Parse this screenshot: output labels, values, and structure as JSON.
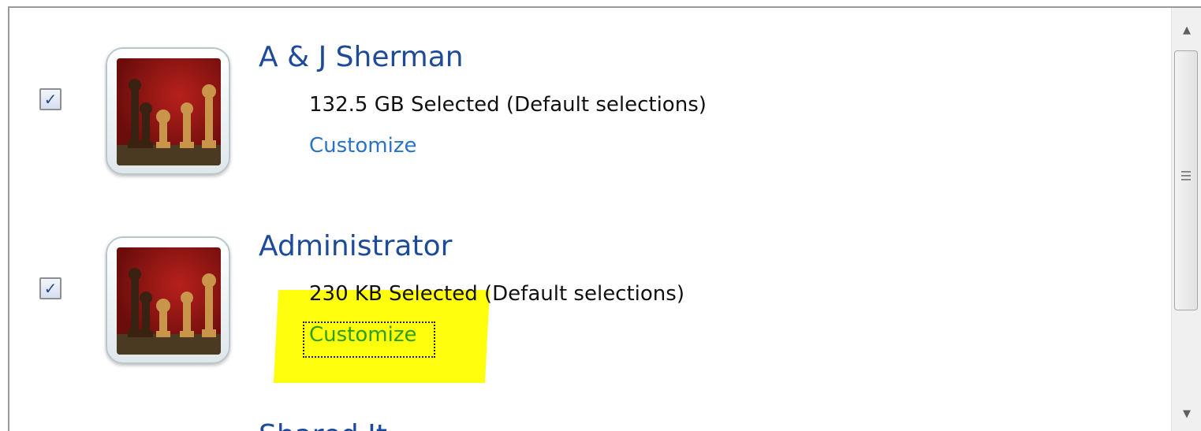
{
  "users": [
    {
      "name": "A & J Sherman",
      "selection": "132.5 GB Selected (Default selections)",
      "customize_label": "Customize",
      "checked": true,
      "avatar_icon": "chess-pieces-icon"
    },
    {
      "name": "Administrator",
      "selection": "230 KB Selected (Default selections)",
      "customize_label": "Customize",
      "checked": true,
      "avatar_icon": "chess-pieces-icon",
      "highlighted": true
    }
  ],
  "partial_item": {
    "label": "Shared It"
  },
  "scrollbar": {
    "up_icon": "scroll-up-arrow-icon",
    "down_icon": "scroll-down-arrow-icon"
  },
  "colors": {
    "name": "#1e4a9a",
    "link": "#2a72c8",
    "highlight": "#ffff00"
  }
}
